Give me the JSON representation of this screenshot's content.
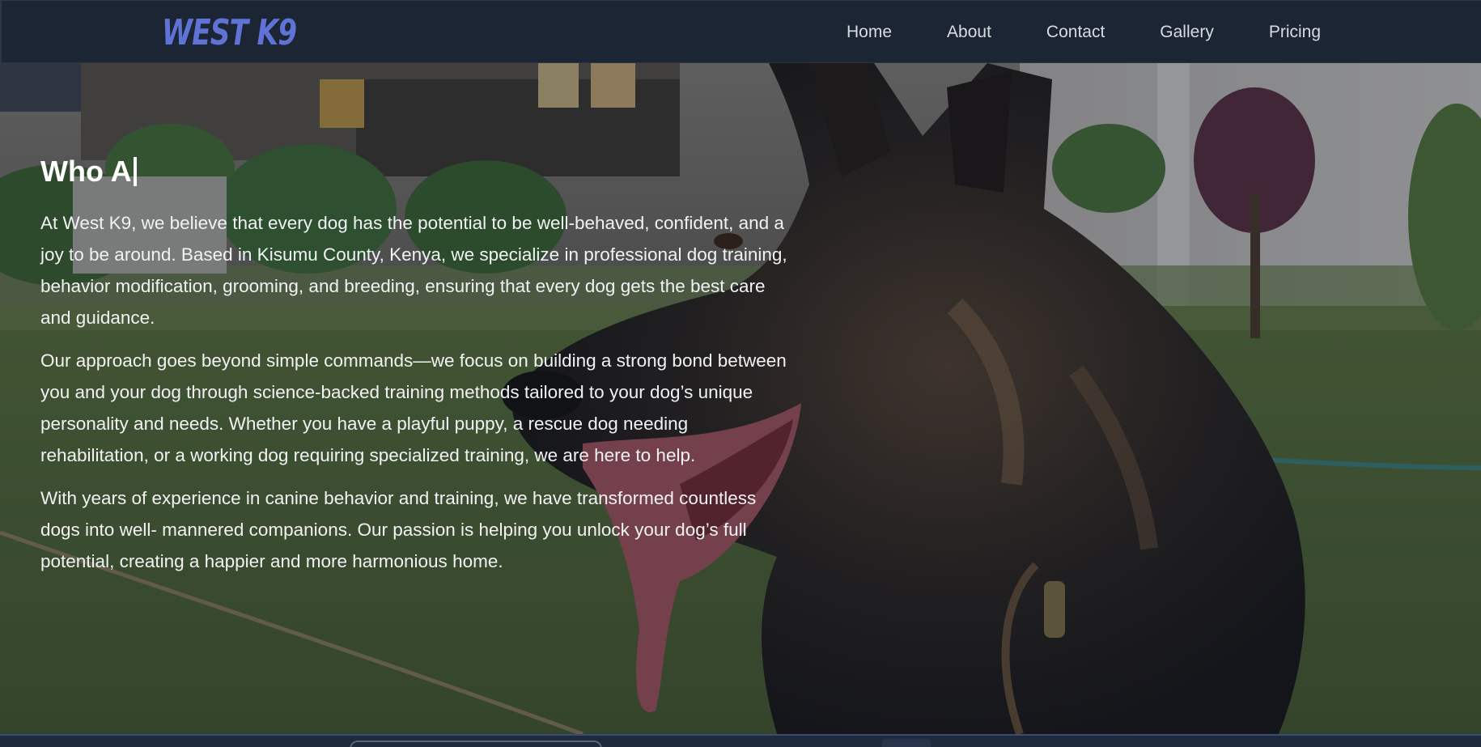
{
  "brand": {
    "logo_text": "WEST K9",
    "accent_color": "#5f72d6"
  },
  "nav": {
    "items": [
      {
        "label": "Home"
      },
      {
        "label": "About"
      },
      {
        "label": "Contact"
      },
      {
        "label": "Gallery"
      },
      {
        "label": "Pricing"
      }
    ]
  },
  "hero": {
    "background_image": "german-shepherd-dog-photo",
    "heading": "Who A",
    "paragraphs": [
      "At West K9, we believe that every dog has the potential to be well-behaved, confident, and a joy to be around. Based in Kisumu County, Kenya, we specialize in professional dog training, behavior modification, grooming, and breeding, ensuring that every dog gets the best care and guidance.",
      "Our approach goes beyond simple commands—we focus on building a strong bond between you and your dog through science-backed training methods tailored to your dog’s unique personality and needs. Whether you have a playful puppy, a rescue dog needing rehabilitation, or a working dog requiring specialized training, we are here to help.",
      "With years of experience in canine behavior and training, we have transformed countless dogs into well- mannered companions. Our passion is helping you unlock your dog’s full potential, creating a happier and more harmonious home."
    ]
  }
}
